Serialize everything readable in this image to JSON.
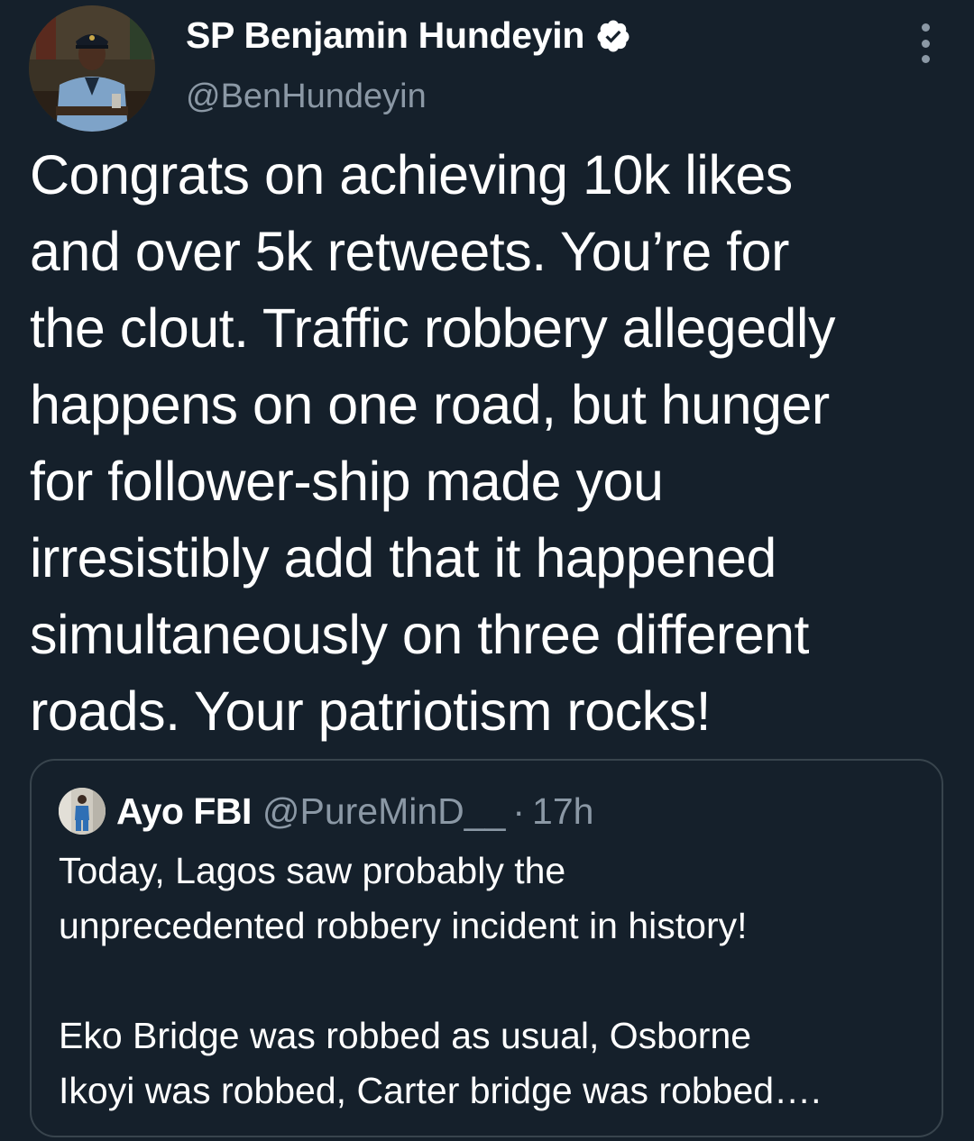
{
  "tweet": {
    "author": {
      "display_name": "SP Benjamin Hundeyin",
      "handle": "@BenHundeyin",
      "verified": true
    },
    "text": "Congrats on achieving 10k likes\nand over 5k retweets. You’re for\nthe clout. Traffic robbery allegedly\nhappens on one road, but hunger\nfor follower-ship made you\nirresistibly add that it happened\nsimultaneously on three different\nroads. Your patriotism rocks!"
  },
  "quoted_tweet": {
    "author": {
      "display_name": "Ayo FBI",
      "handle": "@PureMinD__"
    },
    "separator": "·",
    "time": "17h",
    "text": "Today, Lagos saw probably the\nunprecedented robbery incident in history!\n\nEko Bridge was robbed as usual, Osborne\nIkoyi was robbed, Carter bridge was robbed…."
  },
  "icons": {
    "verified": "verified-badge-icon",
    "more": "more-options-icon"
  },
  "colors": {
    "background": "#15202b",
    "primary_text": "#ffffff",
    "secondary_text": "#8b98a5",
    "border": "#38444d"
  }
}
